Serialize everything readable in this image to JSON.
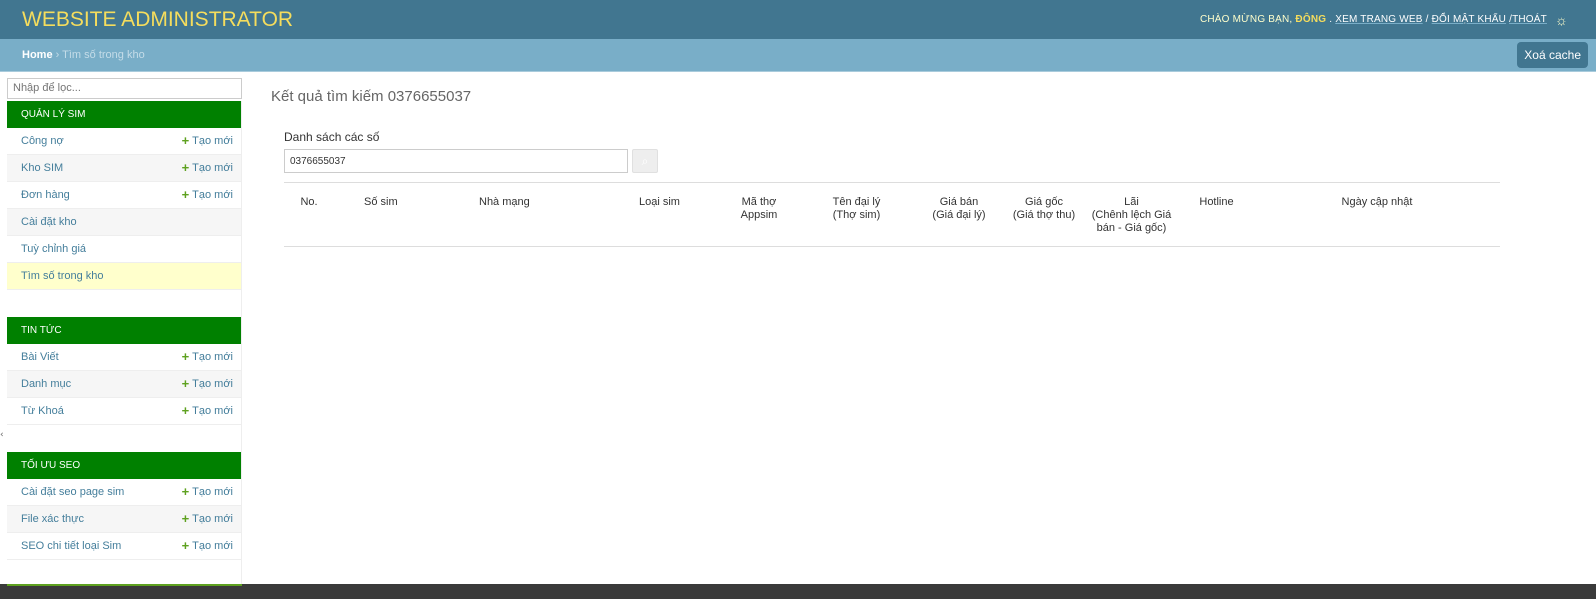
{
  "header": {
    "brand": "WEBSITE ADMINISTRATOR",
    "welcome": "CHÀO MỪNG BẠN,",
    "username": "ĐÔNG",
    "view_site": "XEM TRANG WEB",
    "separator": "/",
    "change_password": "ĐỔI MẬT KHẨU",
    "logout": "/THOÁT",
    "theme_icon": "☼"
  },
  "breadcrumb": {
    "home": "Home",
    "sep": "›",
    "current": "Tìm số trong kho",
    "clear_cache": "Xoá cache"
  },
  "sidebar": {
    "filter_placeholder": "Nhập để lọc...",
    "add_label": "Tạo mới",
    "plus": "+",
    "modules": [
      {
        "title": "QUẢN LÝ SIM",
        "items": [
          {
            "label": "Công nợ",
            "add": true
          },
          {
            "label": "Kho SIM",
            "add": true
          },
          {
            "label": "Đơn hàng",
            "add": true
          },
          {
            "label": "Cài đặt kho",
            "add": false
          },
          {
            "label": "Tuỳ chỉnh giá",
            "add": false
          },
          {
            "label": "Tìm số trong kho",
            "add": false,
            "active": true
          }
        ]
      },
      {
        "title": "TIN TỨC",
        "items": [
          {
            "label": "Bài Viết",
            "add": true
          },
          {
            "label": "Danh mục",
            "add": true
          },
          {
            "label": "Từ Khoá",
            "add": true
          }
        ]
      },
      {
        "title": "TỐI ƯU SEO",
        "items": [
          {
            "label": "Cài đặt seo page sim",
            "add": true
          },
          {
            "label": "File xác thực",
            "add": true
          },
          {
            "label": "SEO chi tiết loại Sim",
            "add": true
          }
        ]
      }
    ]
  },
  "main": {
    "title": "Kết quả tìm kiếm 0376655037",
    "list_label": "Danh sách các số",
    "search_value": "0376655037",
    "search_icon": "🔍",
    "columns": [
      {
        "line1": "No.",
        "line2": "",
        "line3": ""
      },
      {
        "line1": "Số sim",
        "line2": "",
        "line3": ""
      },
      {
        "line1": "Nhà mạng",
        "line2": "",
        "line3": ""
      },
      {
        "line1": "Loại sim",
        "line2": "",
        "line3": ""
      },
      {
        "line1": "Mã thợ",
        "line2": "Appsim",
        "line3": ""
      },
      {
        "line1": "Tên đại lý",
        "line2": "(Thợ sim)",
        "line3": ""
      },
      {
        "line1": "Giá bán",
        "line2": "(Giá đại lý)",
        "line3": ""
      },
      {
        "line1": "Giá gốc",
        "line2": "(Giá thợ thu)",
        "line3": ""
      },
      {
        "line1": "Lãi",
        "line2": "(Chênh lệch Giá",
        "line3": "bán - Giá gốc)"
      },
      {
        "line1": "Hotline",
        "line2": "",
        "line3": ""
      },
      {
        "line1": "Ngày cập nhật",
        "line2": "",
        "line3": ""
      }
    ]
  }
}
